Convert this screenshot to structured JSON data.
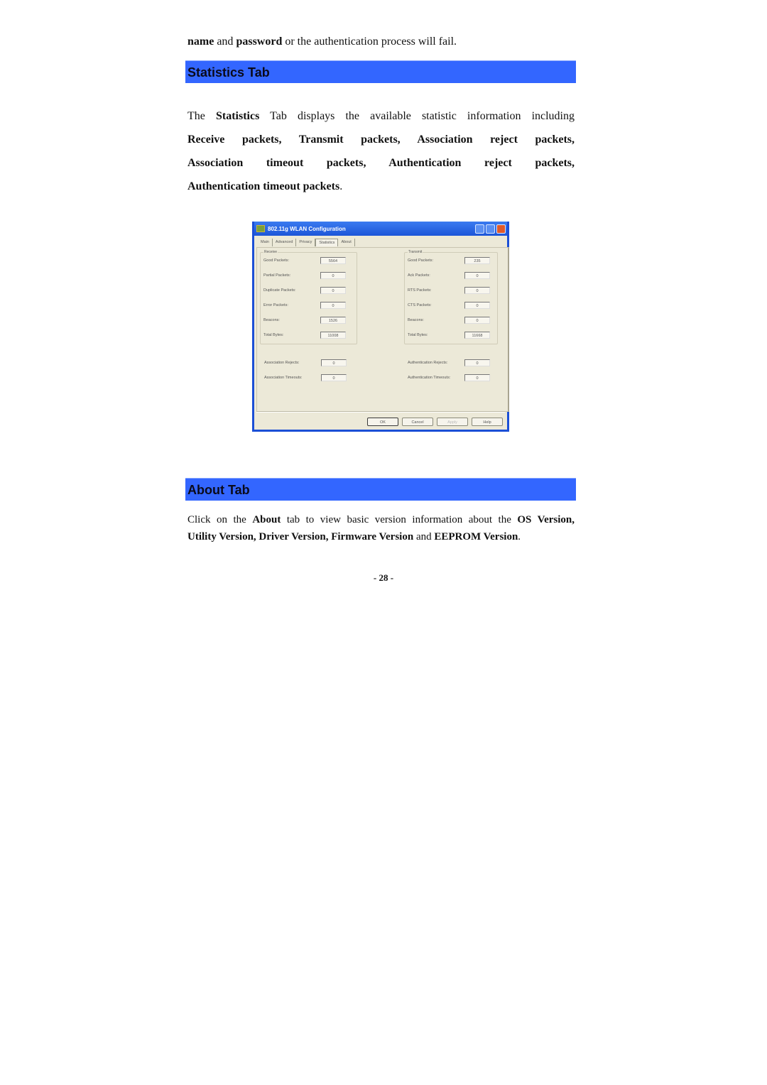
{
  "intro": {
    "bold1": "name",
    "mid1": " and ",
    "bold2": "password",
    "rest": " or the authentication process will fail."
  },
  "statistics_section": {
    "heading": "Statistics Tab",
    "para": {
      "t1": "The ",
      "b1": "Statistics",
      "t2": " Tab displays the available statistic information including",
      "line2": "Receive packets, Transmit packets, Association reject packets,",
      "line3": "Association timeout packets, Authentication reject packets,",
      "line4_bold": "Authentication timeout packets",
      "line4_end": "."
    }
  },
  "dialog": {
    "title": "802.11g WLAN Configuration",
    "tabs": [
      "Main",
      "Advanced",
      "Privacy",
      "Statistics",
      "About"
    ],
    "active_tab": "Statistics",
    "receive": {
      "label": "Receive",
      "rows": [
        {
          "label": "Good Packets:",
          "value": "5564"
        },
        {
          "label": "Partial Packets:",
          "value": "0"
        },
        {
          "label": "Duplicate Packets:",
          "value": "0"
        },
        {
          "label": "Error Packets:",
          "value": "0"
        },
        {
          "label": "Beacons:",
          "value": "1526"
        },
        {
          "label": "Total Bytes:",
          "value": "11008"
        }
      ]
    },
    "transmit": {
      "label": "Transmit",
      "rows": [
        {
          "label": "Good Packets:",
          "value": "235"
        },
        {
          "label": "Ack Packets:",
          "value": "0"
        },
        {
          "label": "RTS Packets:",
          "value": "0"
        },
        {
          "label": "CTS Packets:",
          "value": "0"
        },
        {
          "label": "Beacons:",
          "value": "0"
        },
        {
          "label": "Total Bytes:",
          "value": "11668"
        }
      ]
    },
    "association": [
      {
        "label": "Association Rejects:",
        "value": "0"
      },
      {
        "label": "Association Timeouts:",
        "value": "0"
      }
    ],
    "authentication": [
      {
        "label": "Authentication Rejects:",
        "value": "0"
      },
      {
        "label": "Authentication Timeouts:",
        "value": "0"
      }
    ],
    "buttons": {
      "ok": "OK",
      "cancel": "Cancel",
      "apply": "Apply",
      "help": "Help"
    }
  },
  "about_section": {
    "heading": "About Tab",
    "para": {
      "t1": "Click on the ",
      "b1": "About",
      "t2": " tab to view basic version information about the ",
      "b2": "OS Version,",
      "b3": "Utility Version, Driver Version, Firmware Version",
      "t3": " and ",
      "b4": "EEPROM Version",
      "t4": "."
    }
  },
  "page_number": "- 28 -"
}
